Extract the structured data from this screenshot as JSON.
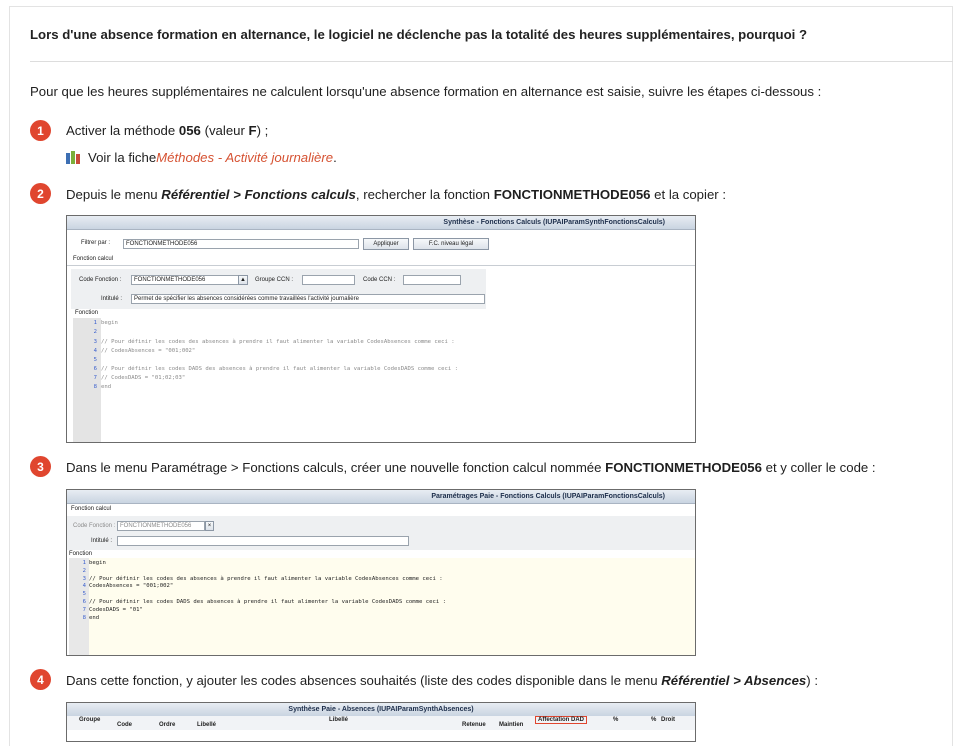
{
  "question": "Lors d'une absence formation en alternance, le logiciel ne déclenche pas la totalité des heures supplémentaires, pourquoi ?",
  "intro": "Pour que les heures supplémentaires ne calculent lorsqu'une absence formation en alternance est saisie, suivre les étapes ci-dessous :",
  "steps": [
    {
      "number": "1",
      "parts": {
        "a": "Activer la méthode ",
        "b": "056",
        "c": " (valeur ",
        "d": "F",
        "e": ") ;"
      },
      "sub": {
        "prefix": "Voir la fiche ",
        "link": "Méthodes - Activité journalière",
        "suffix": "."
      }
    },
    {
      "number": "2",
      "parts": {
        "a": "Depuis le menu ",
        "b": "Référentiel > Fonctions calculs",
        "c": ", rechercher la fonction ",
        "d": "FONCTIONMETHODE056",
        "e": " et la copier :"
      }
    },
    {
      "number": "3",
      "parts": {
        "a": "Dans le menu Paramétrage > Fonctions calculs, créer une nouvelle fonction calcul nommée ",
        "b": "FONCTIONMETHODE056",
        "c": " et y coller le code :"
      }
    },
    {
      "number": "4",
      "parts": {
        "a": "Dans cette fonction, y ajouter les codes absences souhaités (liste des codes disponible dans le menu ",
        "b": "Référentiel > Absences",
        "c": ") :"
      }
    }
  ],
  "shot1": {
    "title": "Synthèse - Fonctions Calculs (IUPAIParamSynthFonctionsCalculs)",
    "filter_label": "Filtrer par :",
    "filter_value": "FONCTIONMETHODE056",
    "apply": "Appliquer",
    "legal": "F.C. niveau légal",
    "section_fc": "Fonction calcul",
    "code_label": "Code Fonction :",
    "code_value": "FONCTIONMETHODE056",
    "ccn_group_label": "Groupe CCN :",
    "ccn_label": "Code CCN :",
    "intitule_label": "Intitulé :",
    "intitule_value": "Permet de spécifier les absences considérées comme travaillées l'activité journalière",
    "section_fn": "Fonction",
    "lines": [
      {
        "n": "1",
        "t": "begin"
      },
      {
        "n": "2",
        "t": ""
      },
      {
        "n": "3",
        "t": "// Pour définir les codes des absences à prendre il faut alimenter la variable CodesAbsences comme ceci :"
      },
      {
        "n": "4",
        "t": "// CodesAbsences = \"001;002\""
      },
      {
        "n": "5",
        "t": ""
      },
      {
        "n": "6",
        "t": "// Pour définir les codes DADS des absences à prendre il faut alimenter la variable CodesDADS comme ceci :"
      },
      {
        "n": "7",
        "t": "// CodesDADS = \"01;02;03\""
      },
      {
        "n": "8",
        "t": "end"
      }
    ]
  },
  "shot2": {
    "title": "Paramétrages Paie - Fonctions Calculs (IUPAIParamFonctionsCalculs)",
    "section_fc": "Fonction calcul",
    "code_label": "Code Fonction :",
    "code_value": "FONCTIONMETHODE056",
    "intitule_label": "Intitulé :",
    "section_fn": "Fonction",
    "lines": [
      {
        "n": "1",
        "t": "begin"
      },
      {
        "n": "2",
        "t": ""
      },
      {
        "n": "3",
        "t": "// Pour définir les codes des absences à prendre il faut alimenter la variable CodesAbsences comme ceci :"
      },
      {
        "n": "4",
        "t": "CodesAbsences = \"001;002\""
      },
      {
        "n": "5",
        "t": ""
      },
      {
        "n": "6",
        "t": "// Pour définir les codes DADS des absences à prendre il faut alimenter la variable CodesDADS comme ceci :"
      },
      {
        "n": "7",
        "t": "CodesDADS = \"01\""
      },
      {
        "n": "8",
        "t": "end"
      }
    ]
  },
  "shot3": {
    "title": "Synthèse Paie - Absences (IUPAIParamSynthAbsences)",
    "columns": [
      "Groupe",
      "Code",
      "Ordre",
      "Libellé",
      "Libellé",
      "Retenue",
      "Maintien",
      "Affectation DAD",
      "%",
      "%",
      "Droit"
    ]
  },
  "colors": {
    "badge": "#e0462f",
    "link": "#d65232"
  },
  "icons": [
    "books-icon"
  ]
}
